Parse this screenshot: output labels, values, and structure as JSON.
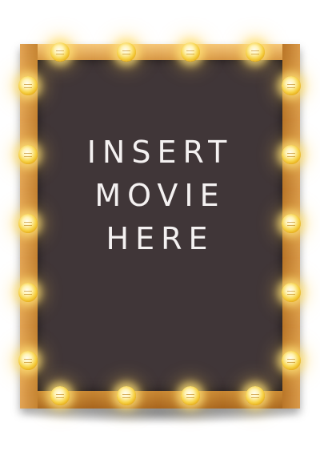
{
  "sign": {
    "text": "INSERT\nMOVIE\nHERE"
  },
  "colors": {
    "frame": "#cf8d3a",
    "board": "#403638",
    "text": "#f4f1f1",
    "bulb": "#f7d34a"
  },
  "bulbs": {
    "icon": "light-bulb-icon",
    "top_count": 4,
    "bottom_count": 4,
    "left_count": 5,
    "right_count": 5
  }
}
